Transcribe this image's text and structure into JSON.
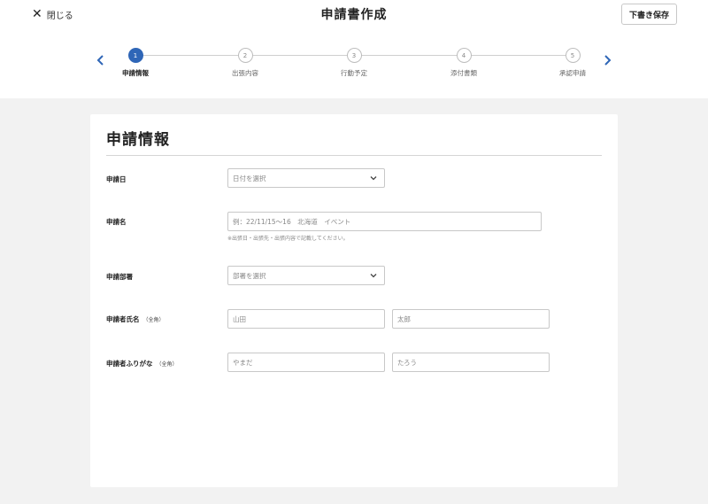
{
  "header": {
    "close_icon": "close-icon",
    "close_label": "閉じる",
    "title": "申請書作成",
    "draft_button": "下書き保存"
  },
  "stepper": {
    "prev_icon": "chevron-left-icon",
    "next_icon": "chevron-right-icon",
    "accent_color": "#2f66b7",
    "active_index": 0,
    "steps": [
      {
        "number": "1",
        "label": "申請情報"
      },
      {
        "number": "2",
        "label": "出張内容"
      },
      {
        "number": "3",
        "label": "行動予定"
      },
      {
        "number": "4",
        "label": "添付書類"
      },
      {
        "number": "5",
        "label": "承認申請"
      }
    ]
  },
  "form": {
    "section_title": "申請情報",
    "application_date": {
      "label": "申請日",
      "placeholder": "日付を選択"
    },
    "application_name": {
      "label": "申請名",
      "placeholder": "例：22/11/15〜16　北海道　イベント",
      "hint": "※出張日・出張先・出張内容で記載してください。"
    },
    "department": {
      "label": "申請部署",
      "placeholder": "部署を選択"
    },
    "applicant_name": {
      "label": "申請者氏名",
      "note": "（全角）",
      "last_placeholder": "山田",
      "first_placeholder": "太郎"
    },
    "applicant_kana": {
      "label": "申請者ふりがな",
      "note": "（全角）",
      "last_placeholder": "やまだ",
      "first_placeholder": "たろう"
    }
  }
}
